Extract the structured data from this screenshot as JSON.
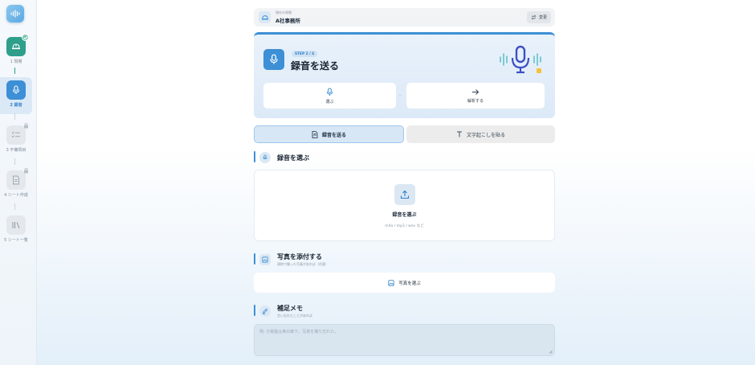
{
  "sidebar": {
    "steps": [
      {
        "label": "1 現場",
        "state": "done",
        "icon": "helmet-icon"
      },
      {
        "label": "2 録音",
        "state": "current",
        "icon": "mic-icon"
      },
      {
        "label": "3 不備項目",
        "state": "locked",
        "icon": "checklist-icon"
      },
      {
        "label": "4 シート作成",
        "state": "locked",
        "icon": "document-icon"
      },
      {
        "label": "5 シート一覧",
        "state": "locked",
        "icon": "library-icon"
      }
    ]
  },
  "site": {
    "caption": "現在の現場",
    "name": "A社事務所",
    "change_label": "変更"
  },
  "step_card": {
    "badge": "STEP 2 / 4",
    "title": "録音を送る",
    "flow": [
      {
        "label": "選ぶ",
        "icon": "mic-icon"
      },
      {
        "label": "解析する",
        "icon": "arrow-right-icon"
      }
    ],
    "separator": "›"
  },
  "tabs": [
    {
      "label": "録音を送る",
      "active": true,
      "icon": "audio-file-icon"
    },
    {
      "label": "文字起こしを貼る",
      "active": false,
      "icon": "text-icon"
    }
  ],
  "recording_section": {
    "title": "録音を選ぶ",
    "upload_title": "録音を選ぶ",
    "formats": "m4a / mp3 / wav など"
  },
  "photo_section": {
    "title": "写真を添付する",
    "subtitle": "現地で撮った写真があれば（任意）",
    "button_label": "写真を選ぶ"
  },
  "memo_section": {
    "title": "補足メモ",
    "subtitle": "言い忘れたことがあれば",
    "placeholder": "例: 分電盤は奥の廊下。写真を撮り忘れた。"
  },
  "colors": {
    "accent": "#3d8fd6",
    "done": "#2f9e8a",
    "locked": "#e4e8ec"
  }
}
